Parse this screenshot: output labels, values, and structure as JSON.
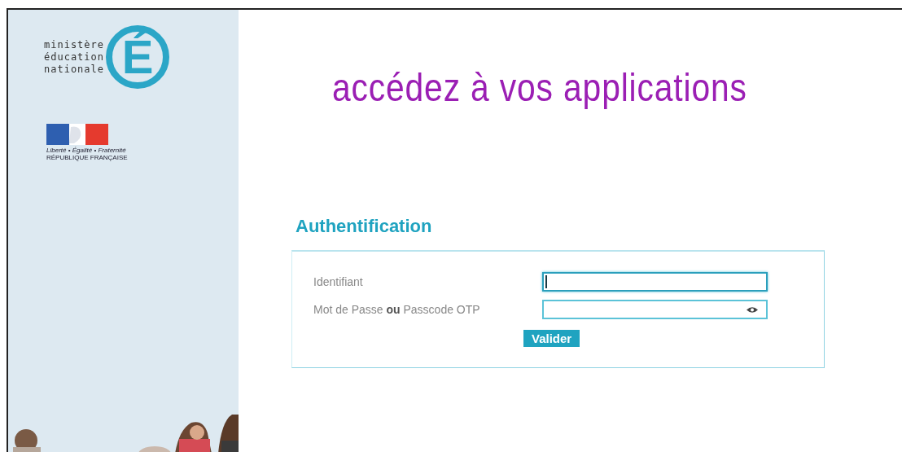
{
  "logo": {
    "lines": [
      "ministère",
      "éducation",
      "nationale"
    ],
    "letter": "É"
  },
  "flag": {
    "motto": "Liberté • Égalité • Fraternité",
    "name": "RÉPUBLIQUE FRANÇAISE"
  },
  "headline": "accédez à vos applications",
  "form": {
    "title": "Authentification",
    "fields": [
      {
        "label": "Identifiant",
        "kind": "text",
        "focused": true
      },
      {
        "label": "Mot de Passe **ou** Passcode OTP",
        "kind": "password",
        "focused": false
      }
    ],
    "submit": "Valider"
  }
}
